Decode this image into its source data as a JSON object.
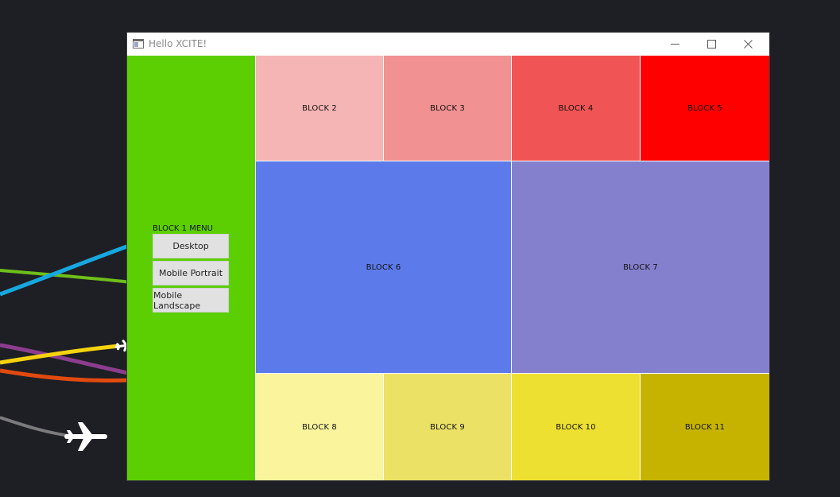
{
  "window": {
    "title": "Hello XCITE!"
  },
  "block1": {
    "menu_title": "BLOCK 1 MENU",
    "buttons": [
      {
        "label": "Desktop"
      },
      {
        "label": "Mobile Portrait"
      },
      {
        "label": "Mobile Landscape"
      }
    ],
    "color": "#5ccf02"
  },
  "blocks": {
    "b2": {
      "label": "BLOCK 2",
      "color": "#f5b5b4"
    },
    "b3": {
      "label": "BLOCK 3",
      "color": "#f19191"
    },
    "b4": {
      "label": "BLOCK 4",
      "color": "#f05454"
    },
    "b5": {
      "label": "BLOCK 5",
      "color": "#ff0000"
    },
    "b6": {
      "label": "BLOCK 6",
      "color": "#5c7aea"
    },
    "b7": {
      "label": "BLOCK 7",
      "color": "#8580cd"
    },
    "b8": {
      "label": "BLOCK 8",
      "color": "#faf59c"
    },
    "b9": {
      "label": "BLOCK 9",
      "color": "#ebe165"
    },
    "b10": {
      "label": "BLOCK 10",
      "color": "#eee030"
    },
    "b11": {
      "label": "BLOCK 11",
      "color": "#c5b300"
    }
  },
  "icons": {
    "app": "app-window-icon",
    "minimize": "minimize-icon",
    "maximize": "maximize-icon",
    "close": "close-icon",
    "airplane": "airplane-icon"
  }
}
